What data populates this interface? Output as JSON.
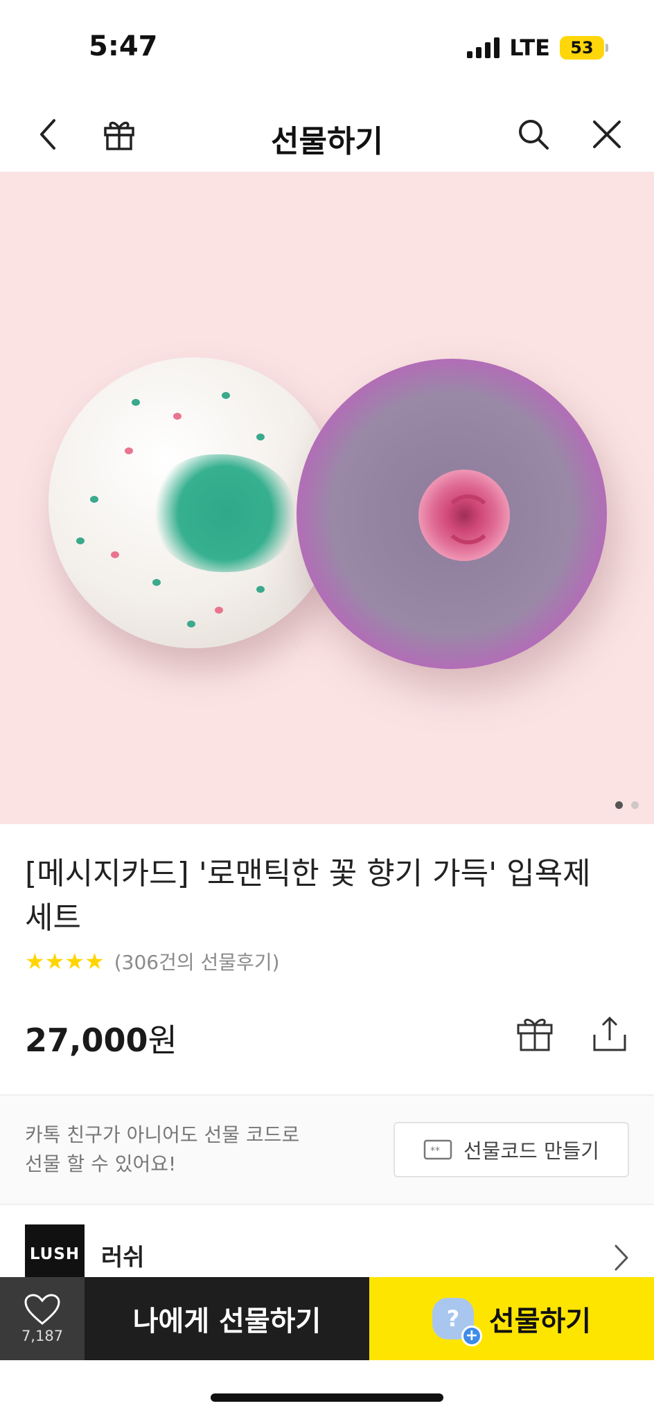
{
  "status_bar": {
    "time": "5:47",
    "network": "LTE",
    "battery": "53",
    "battery_color": "#ffd60a"
  },
  "nav": {
    "title": "선물하기",
    "icons": [
      "back-arrow-icon",
      "gift-icon",
      "search-icon",
      "close-icon"
    ]
  },
  "hero": {
    "page_count": 2,
    "active_page": 1,
    "background": "#fbe3e3"
  },
  "product": {
    "title": "[메시지카드] '로맨틱한 꽃 향기 가득' 입욕제 세트",
    "stars": "★★★★",
    "review_count": "(306건의 선물후기)",
    "price_number": "27,000",
    "price_unit": "원"
  },
  "gift_code": {
    "text_line1": "카톡 친구가 아니어도 선물 코드로",
    "text_line2": "선물 할 수 있어요!",
    "button_label": "선물코드 만들기"
  },
  "brand": {
    "logo_text": "LUSH",
    "name": "러쉬"
  },
  "bottom_bar": {
    "wish_count": "7,187",
    "self_gift_label": "나에게 선물하기",
    "gift_label": "선물하기",
    "gift_badge_symbol": "?",
    "accent": "#fee500"
  }
}
